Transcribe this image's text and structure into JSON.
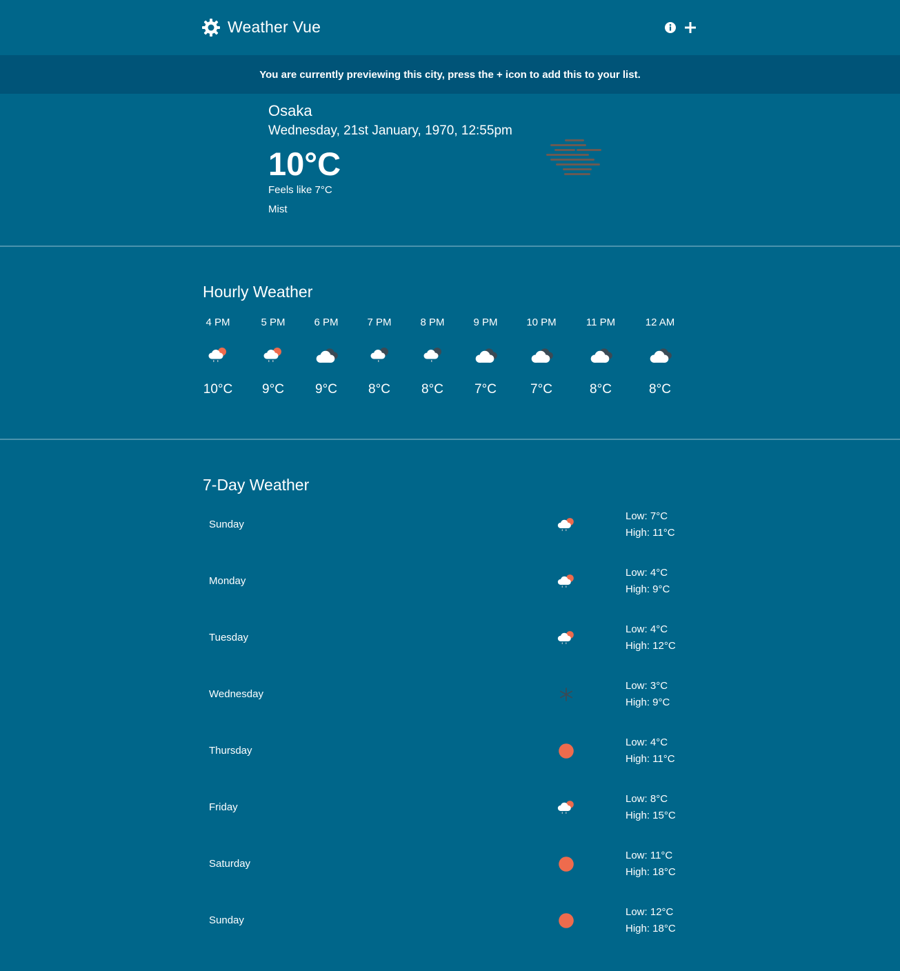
{
  "app": {
    "title": "Weather Vue"
  },
  "banner": {
    "text": "You are currently previewing this city, press the + icon to add this to your list."
  },
  "current": {
    "city": "Osaka",
    "datetime": "Wednesday, 21st January, 1970, 12:55pm",
    "temp": "10°C",
    "feels_like": "Feels like 7°C",
    "description": "Mist",
    "icon": "mist-icon"
  },
  "hourly": {
    "title": "Hourly Weather",
    "items": [
      {
        "time": "4 PM",
        "temp": "10°C",
        "icon": "partly-cloudy-day-icon"
      },
      {
        "time": "5 PM",
        "temp": "9°C",
        "icon": "partly-cloudy-day-icon"
      },
      {
        "time": "6 PM",
        "temp": "9°C",
        "icon": "cloudy-night-icon"
      },
      {
        "time": "7 PM",
        "temp": "8°C",
        "icon": "partly-cloudy-night-icon"
      },
      {
        "time": "8 PM",
        "temp": "8°C",
        "icon": "partly-cloudy-night-icon"
      },
      {
        "time": "9 PM",
        "temp": "7°C",
        "icon": "cloudy-night-icon"
      },
      {
        "time": "10 PM",
        "temp": "7°C",
        "icon": "cloudy-night-icon"
      },
      {
        "time": "11 PM",
        "temp": "8°C",
        "icon": "cloudy-night-icon"
      },
      {
        "time": "12 AM",
        "temp": "8°C",
        "icon": "cloudy-night-icon"
      }
    ]
  },
  "daily": {
    "title": "7-Day Weather",
    "items": [
      {
        "day": "Sunday",
        "low": "Low: 7°C",
        "high": "High: 11°C",
        "icon": "partly-cloudy-day-icon"
      },
      {
        "day": "Monday",
        "low": "Low: 4°C",
        "high": "High: 9°C",
        "icon": "partly-cloudy-day-icon"
      },
      {
        "day": "Tuesday",
        "low": "Low: 4°C",
        "high": "High: 12°C",
        "icon": "partly-cloudy-day-icon"
      },
      {
        "day": "Wednesday",
        "low": "Low: 3°C",
        "high": "High: 9°C",
        "icon": "snow-icon"
      },
      {
        "day": "Thursday",
        "low": "Low: 4°C",
        "high": "High: 11°C",
        "icon": "sun-icon"
      },
      {
        "day": "Friday",
        "low": "Low: 8°C",
        "high": "High: 15°C",
        "icon": "partly-cloudy-day-icon"
      },
      {
        "day": "Saturday",
        "low": "Low: 11°C",
        "high": "High: 18°C",
        "icon": "sun-icon"
      },
      {
        "day": "Sunday",
        "low": "Low: 12°C",
        "high": "High: 18°C",
        "icon": "sun-icon"
      }
    ]
  },
  "colors": {
    "background": "#00668a",
    "banner": "#005478",
    "divider": "#4b93ad",
    "sun": "#ee6b4d",
    "cloud": "#ffffff",
    "dark_cloud": "#3b4a55",
    "mist": "#6b5a52"
  }
}
